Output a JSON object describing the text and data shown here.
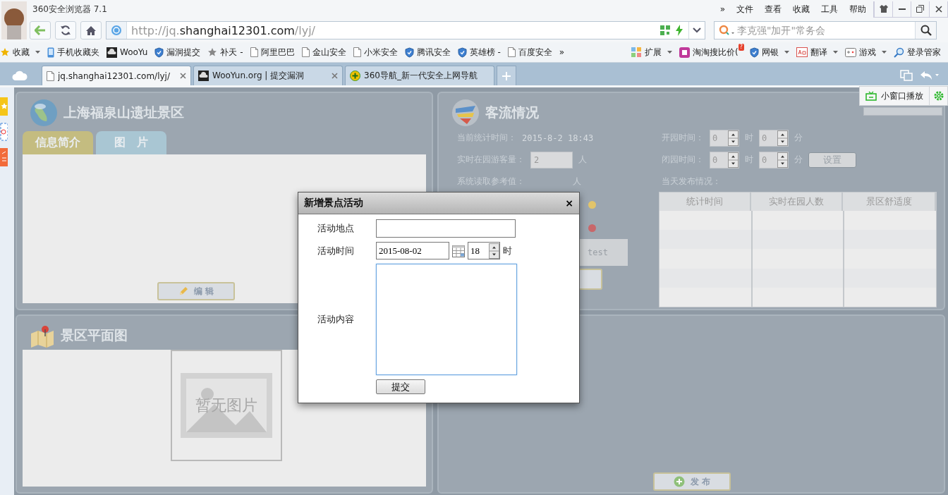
{
  "browser": {
    "title": "360安全浏览器 7.1",
    "menu": [
      "»",
      "文件",
      "查看",
      "收藏",
      "工具",
      "帮助"
    ]
  },
  "address": {
    "scheme": "http://jq.",
    "host": "shanghai12301.com",
    "path": "/lyj/"
  },
  "search": {
    "placeholder": "李克强\"加开\"常务会"
  },
  "bookmarks": [
    {
      "label": "收藏",
      "kind": "folder",
      "dropdown": true
    },
    {
      "label": "手机收藏夹",
      "kind": "phone",
      "dropdown": false
    },
    {
      "label": "WooYu",
      "kind": "logo",
      "dropdown": false
    },
    {
      "label": "漏洞提交",
      "kind": "shield",
      "dropdown": false
    },
    {
      "label": "补天 -",
      "kind": "star",
      "dropdown": false
    },
    {
      "label": "阿里巴巴",
      "kind": "page",
      "dropdown": false
    },
    {
      "label": "金山安全",
      "kind": "page",
      "dropdown": false
    },
    {
      "label": "小米安全",
      "kind": "page",
      "dropdown": false
    },
    {
      "label": "腾讯安全",
      "kind": "shield",
      "dropdown": false
    },
    {
      "label": "英雄榜 -",
      "kind": "shield",
      "dropdown": false
    },
    {
      "label": "百度安全",
      "kind": "page",
      "dropdown": false
    }
  ],
  "bookmarks_more": "»",
  "extensions": [
    {
      "label": "扩展",
      "kind": "grid",
      "dropdown": true
    },
    {
      "label": "淘淘搜比价(",
      "kind": "tag",
      "dropdown": false,
      "badge": "?"
    },
    {
      "label": "网银",
      "kind": "shield",
      "dropdown": true
    },
    {
      "label": "翻译",
      "kind": "translate",
      "dropdown": true
    },
    {
      "label": "游戏",
      "kind": "gamepad",
      "dropdown": true
    },
    {
      "label": "登录管家",
      "kind": "key",
      "dropdown": false
    }
  ],
  "tabs": [
    {
      "label": "jq.shanghai12301.com/lyj/",
      "kind": "page",
      "selected": true
    },
    {
      "label": "WooYun.org | 提交漏洞",
      "kind": "logo",
      "selected": false
    },
    {
      "label": "360导航_新一代安全上网导航",
      "kind": "plus",
      "selected": false
    }
  ],
  "float_player": {
    "label": "小窗口播放"
  },
  "scenic": {
    "title": "上海福泉山遗址景区",
    "tabs": [
      {
        "label": "信息简介",
        "selected": true
      },
      {
        "label": "图　片",
        "selected": false
      }
    ],
    "edit_button": "编 辑"
  },
  "map": {
    "title": "景区平面图",
    "placeholder": "暂无图片"
  },
  "flow": {
    "title": "客流情况",
    "stat_time_label": "当前统计时间：",
    "stat_time": "2015-8-2 18:43",
    "visitors_label": "实时在园游客量：",
    "visitors": "2",
    "visitors_unit": "人",
    "reference_label": "系统读取参考值：",
    "reference_unit": "人",
    "open": {
      "label": "开园时间：",
      "hour": "0",
      "hour_unit": "时",
      "minute": "0",
      "minute_unit": "分"
    },
    "close": {
      "label": "闭园时间：",
      "hour": "0",
      "hour_unit": "时",
      "minute": "0",
      "minute_unit": "分"
    },
    "set_button": "设置",
    "publish_label": "当天发布情况：",
    "legend": [
      {
        "color": "#e2c46a"
      },
      {
        "color": "#c8676a"
      }
    ],
    "test_text": "test",
    "table": {
      "columns": [
        "统计时间",
        "实时在园人数",
        "景区舒适度"
      ]
    },
    "publish_button": "发 布"
  },
  "dialog": {
    "title": "新增景点活动",
    "close": "×",
    "place_label": "活动地点",
    "time_label": "活动时间",
    "date": "2015-08-02",
    "hour": "18",
    "hour_unit": "时",
    "content_label": "活动内容",
    "submit": "提交"
  }
}
